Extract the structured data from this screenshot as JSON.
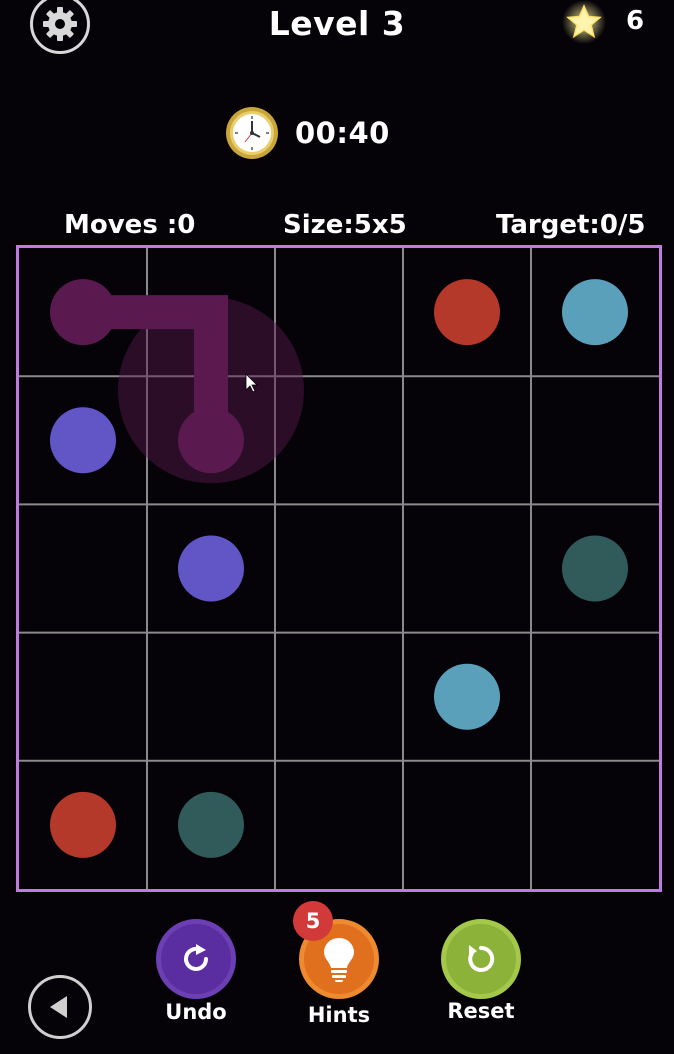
{
  "header": {
    "title": "Level 3",
    "stars": "6"
  },
  "timer": {
    "value": "00:40"
  },
  "stats": {
    "moves": "Moves :0",
    "size": "Size:5x5",
    "target": "Target:0/5"
  },
  "board": {
    "rows": 5,
    "cols": 5,
    "dots": [
      {
        "row": 0,
        "col": 3,
        "color": "#b5392a",
        "name": "red"
      },
      {
        "row": 0,
        "col": 4,
        "color": "#5aa0ba",
        "name": "light-blue"
      },
      {
        "row": 1,
        "col": 0,
        "color": "#6256c6",
        "name": "purple"
      },
      {
        "row": 2,
        "col": 1,
        "color": "#6256c6",
        "name": "purple"
      },
      {
        "row": 2,
        "col": 4,
        "color": "#305b5a",
        "name": "teal"
      },
      {
        "row": 3,
        "col": 3,
        "color": "#5aa0ba",
        "name": "light-blue"
      },
      {
        "row": 4,
        "col": 0,
        "color": "#b5392a",
        "name": "red"
      },
      {
        "row": 4,
        "col": 1,
        "color": "#305b5a",
        "name": "teal"
      }
    ],
    "active_path": {
      "color": "#5a1a50",
      "cells": [
        [
          0,
          0
        ],
        [
          0,
          1
        ],
        [
          1,
          1
        ]
      ]
    },
    "grid_color": "#8a8a8a",
    "border_color": "#c07be0"
  },
  "buttons": {
    "undo": "Undo",
    "hints": "Hints",
    "hints_count": "5",
    "reset": "Reset"
  },
  "colors": {
    "background": "#050308",
    "undo": "#5a2ea0",
    "hints": "#e0701e",
    "reset": "#8db23a",
    "badge": "#d23a3a"
  }
}
